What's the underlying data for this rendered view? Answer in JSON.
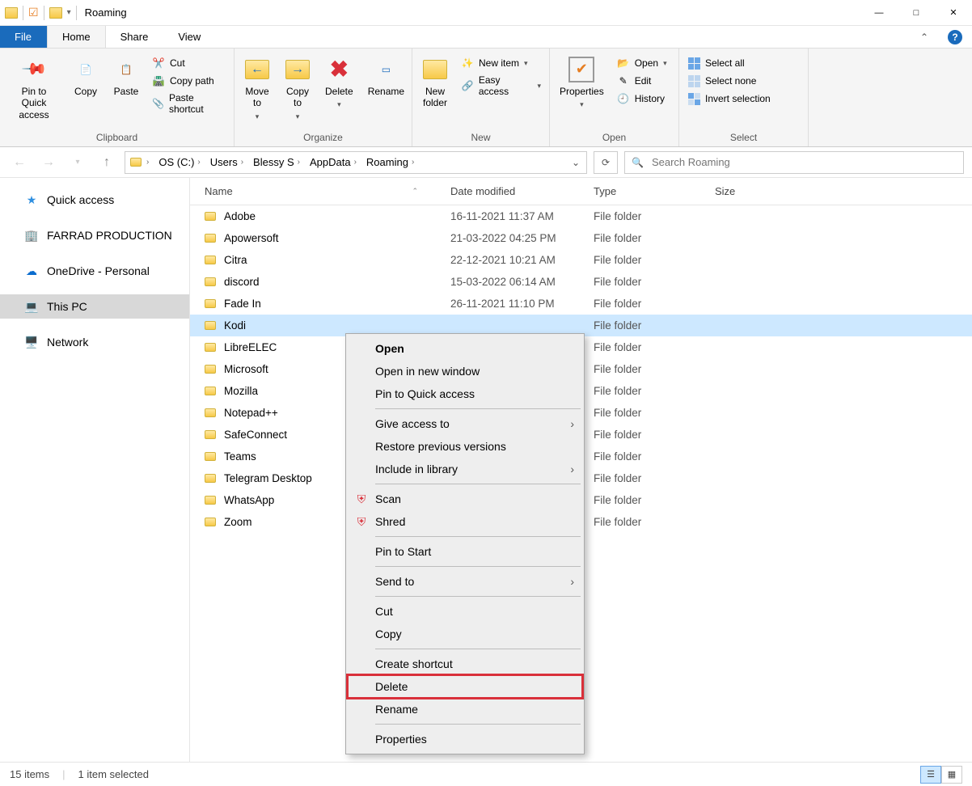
{
  "window": {
    "title": "Roaming"
  },
  "tabs": {
    "file": "File",
    "home": "Home",
    "share": "Share",
    "view": "View"
  },
  "ribbon": {
    "clipboard": {
      "label": "Clipboard",
      "pin": "Pin to Quick\naccess",
      "copy": "Copy",
      "paste": "Paste",
      "cut": "Cut",
      "copy_path": "Copy path",
      "paste_shortcut": "Paste shortcut"
    },
    "organize": {
      "label": "Organize",
      "move_to": "Move\nto",
      "copy_to": "Copy\nto",
      "delete": "Delete",
      "rename": "Rename"
    },
    "new": {
      "label": "New",
      "new_folder": "New\nfolder",
      "new_item": "New item",
      "easy_access": "Easy access"
    },
    "open": {
      "label": "Open",
      "properties": "Properties",
      "open": "Open",
      "edit": "Edit",
      "history": "History"
    },
    "select": {
      "label": "Select",
      "select_all": "Select all",
      "select_none": "Select none",
      "invert": "Invert selection"
    }
  },
  "breadcrumbs": [
    "OS (C:)",
    "Users",
    "Blessy S",
    "AppData",
    "Roaming"
  ],
  "search": {
    "placeholder": "Search Roaming"
  },
  "sidebar": {
    "quick_access": "Quick access",
    "farrad": "FARRAD PRODUCTION",
    "onedrive": "OneDrive - Personal",
    "this_pc": "This PC",
    "network": "Network"
  },
  "columns": {
    "name": "Name",
    "date": "Date modified",
    "type": "Type",
    "size": "Size"
  },
  "file_type": "File folder",
  "rows": [
    {
      "name": "Adobe",
      "date": "16-11-2021 11:37 AM",
      "selected": false
    },
    {
      "name": "Apowersoft",
      "date": "21-03-2022 04:25 PM",
      "selected": false
    },
    {
      "name": "Citra",
      "date": "22-12-2021 10:21 AM",
      "selected": false
    },
    {
      "name": "discord",
      "date": "15-03-2022 06:14 AM",
      "selected": false
    },
    {
      "name": "Fade In",
      "date": "26-11-2021 11:10 PM",
      "selected": false
    },
    {
      "name": "Kodi",
      "date": "",
      "selected": true
    },
    {
      "name": "LibreELEC",
      "date": "",
      "selected": false
    },
    {
      "name": "Microsoft",
      "date": "",
      "selected": false
    },
    {
      "name": "Mozilla",
      "date": "",
      "selected": false
    },
    {
      "name": "Notepad++",
      "date": "",
      "selected": false
    },
    {
      "name": "SafeConnect",
      "date": "",
      "selected": false
    },
    {
      "name": "Teams",
      "date": "",
      "selected": false
    },
    {
      "name": "Telegram Desktop",
      "date": "",
      "selected": false
    },
    {
      "name": "WhatsApp",
      "date": "",
      "selected": false
    },
    {
      "name": "Zoom",
      "date": "",
      "selected": false
    }
  ],
  "context_menu": {
    "open": "Open",
    "open_new_window": "Open in new window",
    "pin_quick": "Pin to Quick access",
    "give_access": "Give access to",
    "restore_prev": "Restore previous versions",
    "include_library": "Include in library",
    "scan": "Scan",
    "shred": "Shred",
    "pin_start": "Pin to Start",
    "send_to": "Send to",
    "cut": "Cut",
    "copy": "Copy",
    "create_shortcut": "Create shortcut",
    "delete": "Delete",
    "rename": "Rename",
    "properties": "Properties"
  },
  "status": {
    "items": "15 items",
    "selected": "1 item selected"
  }
}
